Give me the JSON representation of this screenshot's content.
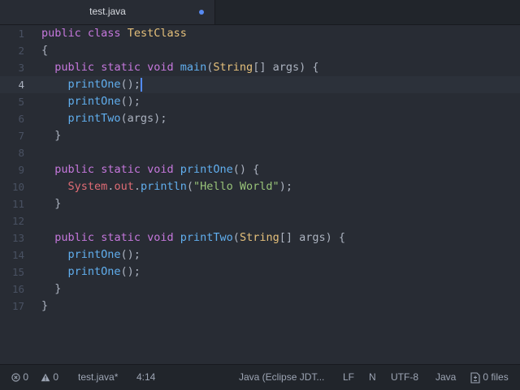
{
  "tab": {
    "title": "test.java",
    "modified": true
  },
  "editor": {
    "cursor_line": 4,
    "lines": [
      [
        {
          "t": "public",
          "c": "kw"
        },
        {
          "t": " "
        },
        {
          "t": "class",
          "c": "kw"
        },
        {
          "t": " "
        },
        {
          "t": "TestClass",
          "c": "cls"
        }
      ],
      [
        {
          "t": "{"
        }
      ],
      [
        {
          "t": "  "
        },
        {
          "t": "public",
          "c": "kw"
        },
        {
          "t": " "
        },
        {
          "t": "static",
          "c": "kw"
        },
        {
          "t": " "
        },
        {
          "t": "void",
          "c": "kw"
        },
        {
          "t": " "
        },
        {
          "t": "main",
          "c": "fn"
        },
        {
          "t": "("
        },
        {
          "t": "String",
          "c": "cls"
        },
        {
          "t": "[] args) {"
        }
      ],
      [
        {
          "t": "    "
        },
        {
          "t": "printOne",
          "c": "fn"
        },
        {
          "t": "();"
        }
      ],
      [
        {
          "t": "    "
        },
        {
          "t": "printOne",
          "c": "fn"
        },
        {
          "t": "();"
        }
      ],
      [
        {
          "t": "    "
        },
        {
          "t": "printTwo",
          "c": "fn"
        },
        {
          "t": "(args);"
        }
      ],
      [
        {
          "t": "  }"
        }
      ],
      [],
      [
        {
          "t": "  "
        },
        {
          "t": "public",
          "c": "kw"
        },
        {
          "t": " "
        },
        {
          "t": "static",
          "c": "kw"
        },
        {
          "t": " "
        },
        {
          "t": "void",
          "c": "kw"
        },
        {
          "t": " "
        },
        {
          "t": "printOne",
          "c": "fn"
        },
        {
          "t": "() {"
        }
      ],
      [
        {
          "t": "    "
        },
        {
          "t": "System",
          "c": "field"
        },
        {
          "t": "."
        },
        {
          "t": "out",
          "c": "field"
        },
        {
          "t": "."
        },
        {
          "t": "println",
          "c": "fn"
        },
        {
          "t": "("
        },
        {
          "t": "\"Hello World\"",
          "c": "str"
        },
        {
          "t": ");"
        }
      ],
      [
        {
          "t": "  }"
        }
      ],
      [],
      [
        {
          "t": "  "
        },
        {
          "t": "public",
          "c": "kw"
        },
        {
          "t": " "
        },
        {
          "t": "static",
          "c": "kw"
        },
        {
          "t": " "
        },
        {
          "t": "void",
          "c": "kw"
        },
        {
          "t": " "
        },
        {
          "t": "printTwo",
          "c": "fn"
        },
        {
          "t": "("
        },
        {
          "t": "String",
          "c": "cls"
        },
        {
          "t": "[] args) {"
        }
      ],
      [
        {
          "t": "    "
        },
        {
          "t": "printOne",
          "c": "fn"
        },
        {
          "t": "();"
        }
      ],
      [
        {
          "t": "    "
        },
        {
          "t": "printOne",
          "c": "fn"
        },
        {
          "t": "();"
        }
      ],
      [
        {
          "t": "  }"
        }
      ],
      [
        {
          "t": "}"
        }
      ]
    ]
  },
  "status": {
    "errors": "0",
    "warnings": "0",
    "file": "test.java*",
    "cursor_pos": "4:14",
    "grammar": "Java (Eclipse JDT...",
    "line_ending": "LF",
    "indent": "N",
    "encoding": "UTF-8",
    "language": "Java",
    "files": "0 files"
  }
}
